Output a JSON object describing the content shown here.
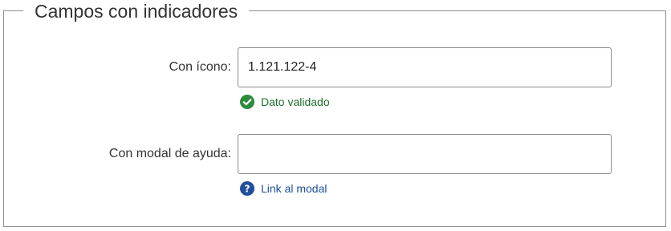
{
  "fieldset": {
    "legend": "Campos con indicadores"
  },
  "fields": {
    "icon_field": {
      "label": "Con ícono:",
      "value": "1.121.122-4",
      "status_text": "Dato validado",
      "status_icon": "check-circle-icon",
      "status_color": "#2e8b3d"
    },
    "help_field": {
      "label": "Con modal de ayuda:",
      "value": "",
      "link_text": "Link al modal",
      "link_icon": "question-circle-icon",
      "link_color": "#1f4f9c"
    }
  }
}
